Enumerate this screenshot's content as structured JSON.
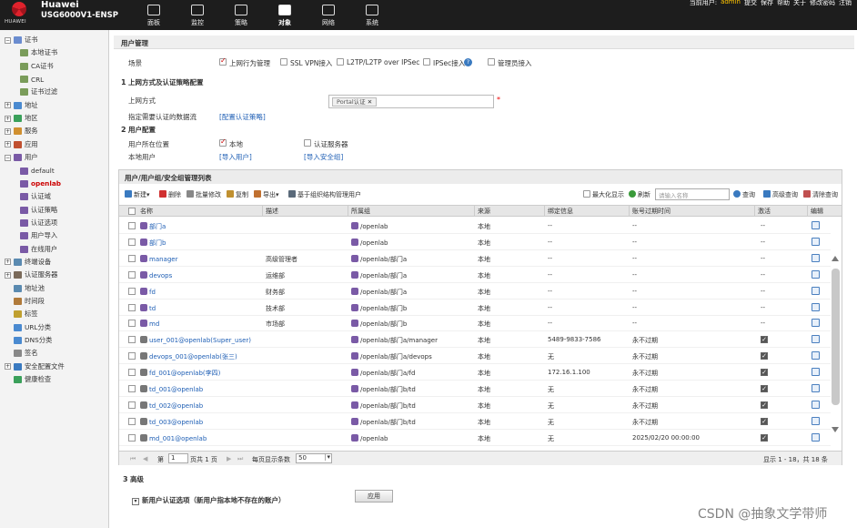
{
  "brand": {
    "logo_text": "HUAWEI",
    "name": "Huawei",
    "model": "USG6000V1-ENSP"
  },
  "nav": [
    {
      "label": "面板",
      "icon": "dashboard-icon"
    },
    {
      "label": "监控",
      "icon": "monitor-icon"
    },
    {
      "label": "策略",
      "icon": "policy-icon"
    },
    {
      "label": "对象",
      "icon": "object-icon",
      "active": true
    },
    {
      "label": "网络",
      "icon": "network-icon"
    },
    {
      "label": "系统",
      "icon": "system-icon"
    }
  ],
  "topbar": {
    "current_user_label": "当前用户:",
    "current_user": "admin",
    "links": [
      "提交",
      "保存",
      "帮助",
      "关于",
      "修改密码",
      "注销"
    ]
  },
  "sidebar": [
    {
      "label": "证书",
      "depth": 0,
      "exp": "⊟",
      "color": "#6a8ccf"
    },
    {
      "label": "本地证书",
      "depth": 1,
      "color": "#7a9c5a"
    },
    {
      "label": "CA证书",
      "depth": 1,
      "color": "#7a9c5a"
    },
    {
      "label": "CRL",
      "depth": 1,
      "color": "#7a9c5a"
    },
    {
      "label": "证书过滤",
      "depth": 1,
      "color": "#7a9c5a"
    },
    {
      "label": "地址",
      "depth": 0,
      "exp": "⊞",
      "color": "#4a8ad0"
    },
    {
      "label": "地区",
      "depth": 0,
      "exp": "⊞",
      "color": "#3aa05a"
    },
    {
      "label": "服务",
      "depth": 0,
      "exp": "⊞",
      "color": "#d09030"
    },
    {
      "label": "应用",
      "depth": 0,
      "exp": "⊞",
      "color": "#c05030"
    },
    {
      "label": "用户",
      "depth": 0,
      "exp": "⊟",
      "color": "#7a5aa6"
    },
    {
      "label": "default",
      "depth": 1,
      "color": "#7a5aa6"
    },
    {
      "label": "openlab",
      "depth": 1,
      "color": "#7a5aa6",
      "selected": true
    },
    {
      "label": "认证域",
      "depth": 1,
      "color": "#7a5aa6"
    },
    {
      "label": "认证策略",
      "depth": 1,
      "color": "#7a5aa6"
    },
    {
      "label": "认证选项",
      "depth": 1,
      "color": "#7a5aa6"
    },
    {
      "label": "用户导入",
      "depth": 1,
      "color": "#7a5aa6"
    },
    {
      "label": "在线用户",
      "depth": 1,
      "color": "#7a5aa6"
    },
    {
      "label": "终端设备",
      "depth": 0,
      "exp": "⊞",
      "color": "#5a8ab0"
    },
    {
      "label": "认证服务器",
      "depth": 0,
      "exp": "⊞",
      "color": "#7a6a5a"
    },
    {
      "label": "地址池",
      "depth": 0,
      "color": "#5a8ab0"
    },
    {
      "label": "时间段",
      "depth": 0,
      "color": "#b07a3a"
    },
    {
      "label": "标签",
      "depth": 0,
      "color": "#c0a030"
    },
    {
      "label": "URL分类",
      "depth": 0,
      "color": "#4a8ad0"
    },
    {
      "label": "DNS分类",
      "depth": 0,
      "color": "#4a8ad0"
    },
    {
      "label": "签名",
      "depth": 0,
      "color": "#888"
    },
    {
      "label": "安全配置文件",
      "depth": 0,
      "exp": "⊞",
      "color": "#3a7ac0"
    },
    {
      "label": "健康检查",
      "depth": 0,
      "color": "#3aa05a"
    }
  ],
  "user_mgmt": {
    "title": "用户管理",
    "scene_label": "场景",
    "scenes": [
      {
        "label": "上网行为管理",
        "checked": true
      },
      {
        "label": "SSL VPN接入",
        "checked": false
      },
      {
        "label": "L2TP/L2TP over IPSec",
        "checked": false
      },
      {
        "label": "IPSec接入",
        "checked": false
      },
      {
        "label": "管理员接入",
        "checked": false
      }
    ],
    "step1_no": "1",
    "step1_title": "上网方式及认证策略配置",
    "access_label": "上网方式",
    "access_value": "Portal认证",
    "required_mark": "*",
    "flow_label": "指定需要认证的数据流",
    "flow_link": "[配置认证策略]",
    "step2_no": "2",
    "step2_title": "用户配置",
    "location_label": "用户所在位置",
    "location_local": "本地",
    "location_server": "认证服务器",
    "local_user_label": "本地用户",
    "import_user": "[导入用户]",
    "import_group": "[导入安全组]"
  },
  "panel": {
    "title": "用户/用户组/安全组管理列表",
    "toolbar": [
      "新建",
      "删除",
      "批量修改",
      "复制",
      "导出",
      "基于组织结构管理用户"
    ],
    "maximize": "最大化显示",
    "refresh": "刷新",
    "search_placeholder": "请输入名称",
    "search": "查询",
    "advanced": "高级查询",
    "clear": "清除查询",
    "columns": [
      "名称",
      "描述",
      "所属组",
      "来源",
      "绑定信息",
      "账号过期时间",
      "激活",
      "编辑"
    ],
    "rows": [
      {
        "type": "grp",
        "name": "部门a",
        "desc": "",
        "group": "/openlab",
        "source": "本地",
        "bind": "--",
        "expire": "--",
        "active": "--"
      },
      {
        "type": "grp",
        "name": "部门b",
        "desc": "",
        "group": "/openlab",
        "source": "本地",
        "bind": "--",
        "expire": "--",
        "active": "--"
      },
      {
        "type": "grp",
        "name": "manager",
        "desc": "高级管理者",
        "group": "/openlab/部门a",
        "source": "本地",
        "bind": "--",
        "expire": "--",
        "active": "--"
      },
      {
        "type": "grp",
        "name": "devops",
        "desc": "运维部",
        "group": "/openlab/部门a",
        "source": "本地",
        "bind": "--",
        "expire": "--",
        "active": "--"
      },
      {
        "type": "grp",
        "name": "fd",
        "desc": "财务部",
        "group": "/openlab/部门a",
        "source": "本地",
        "bind": "--",
        "expire": "--",
        "active": "--"
      },
      {
        "type": "grp",
        "name": "td",
        "desc": "技术部",
        "group": "/openlab/部门b",
        "source": "本地",
        "bind": "--",
        "expire": "--",
        "active": "--"
      },
      {
        "type": "grp",
        "name": "md",
        "desc": "市场部",
        "group": "/openlab/部门b",
        "source": "本地",
        "bind": "--",
        "expire": "--",
        "active": "--"
      },
      {
        "type": "usr",
        "name": "user_001@openlab(Super_user)",
        "desc": "",
        "group": "/openlab/部门a/manager",
        "source": "本地",
        "bind": "5489-9833-7586",
        "expire": "永不过期",
        "active": true
      },
      {
        "type": "usr",
        "name": "devops_001@openlab(张三)",
        "desc": "",
        "group": "/openlab/部门a/devops",
        "source": "本地",
        "bind": "无",
        "expire": "永不过期",
        "active": true
      },
      {
        "type": "usr",
        "name": "fd_001@openlab(李四)",
        "desc": "",
        "group": "/openlab/部门a/fd",
        "source": "本地",
        "bind": "172.16.1.100",
        "expire": "永不过期",
        "active": true
      },
      {
        "type": "usr",
        "name": "td_001@openlab",
        "desc": "",
        "group": "/openlab/部门b/td",
        "source": "本地",
        "bind": "无",
        "expire": "永不过期",
        "active": true
      },
      {
        "type": "usr",
        "name": "td_002@openlab",
        "desc": "",
        "group": "/openlab/部门b/td",
        "source": "本地",
        "bind": "无",
        "expire": "永不过期",
        "active": true
      },
      {
        "type": "usr",
        "name": "td_003@openlab",
        "desc": "",
        "group": "/openlab/部门b/td",
        "source": "本地",
        "bind": "无",
        "expire": "永不过期",
        "active": true
      },
      {
        "type": "usr",
        "name": "md_001@openlab",
        "desc": "",
        "group": "/openlab",
        "source": "本地",
        "bind": "无",
        "expire": "2025/02/20 00:00:00",
        "active": true
      }
    ],
    "pager": {
      "first_label": "第",
      "page": "1",
      "total_pages": "页共 1 页",
      "per_page_label": "每页显示条数",
      "per_page": "50",
      "summary": "显示 1 - 18，共 18 条"
    }
  },
  "advanced": {
    "no": "3",
    "title": "高级",
    "option": "新用户认证选项（新用户指本地不存在的账户）"
  },
  "apply": "应用",
  "watermark": "CSDN @抽象文学带师"
}
